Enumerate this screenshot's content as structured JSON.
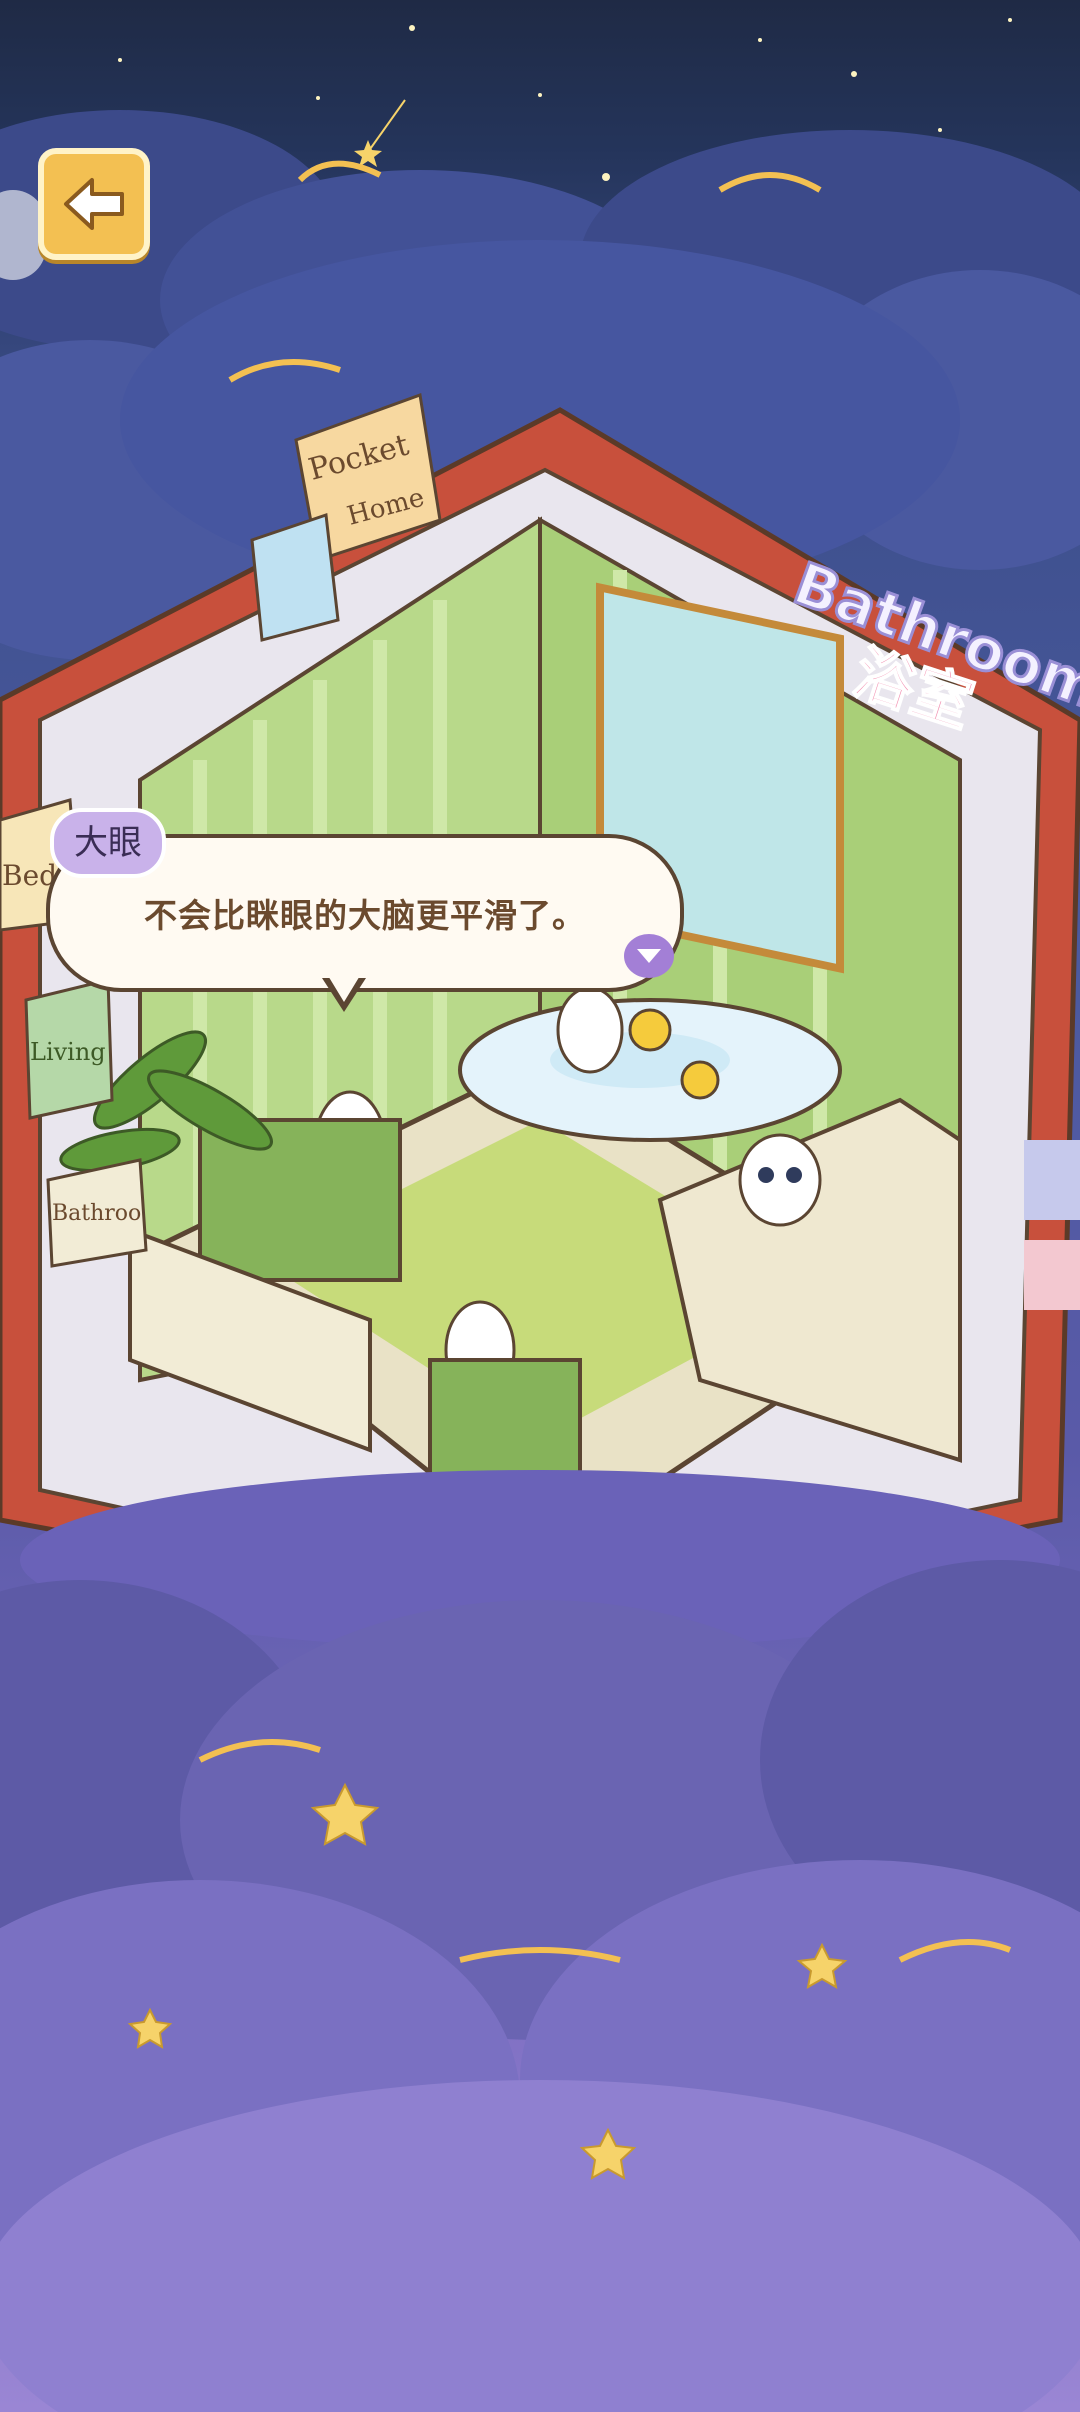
{
  "dialogue": {
    "speaker": "大眼",
    "text": "不会比眯眼的大脑更平滑了。"
  },
  "room": {
    "title_en": "Bathroom",
    "title_cn": "浴室",
    "pinned_note": "Pocket Home",
    "side_tabs": [
      "Bed",
      "Living",
      "Bathroo"
    ]
  },
  "icons": {
    "back": "back-arrow-icon",
    "next": "triangle-down-icon"
  },
  "colors": {
    "night_sky": "#1f2a45",
    "clouds": "#4b5aa0",
    "back_button": "#f3c052",
    "book_cover": "#c8503c",
    "room_wall": "#b8d98a",
    "name_tag": "#c9b2ea",
    "bubble": "#fffaf2"
  }
}
